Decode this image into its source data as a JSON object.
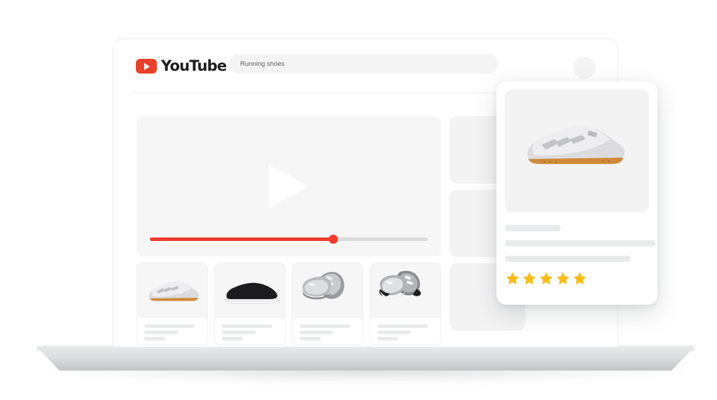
{
  "device": {
    "kind": "laptop-mockup"
  },
  "browser": {
    "brand": {
      "name": "YouTube",
      "logo_icon": "youtube-play-badge-icon",
      "badge_color": "#E8402A"
    },
    "search": {
      "value": "Running shoes",
      "placeholder": "Search"
    },
    "account_avatar_icon": "avatar-circle-icon"
  },
  "video": {
    "play_icon": "play-triangle-icon",
    "progress_percent": 66,
    "progress_color": "#F03C2E",
    "track_color": "#D9DADB"
  },
  "product_thumbnails": [
    {
      "image_icon": "white-gum-sole-sneaker-icon",
      "line_widths": [
        72,
        48,
        30
      ]
    },
    {
      "image_icon": "black-slipon-sneaker-icon",
      "line_widths": [
        72,
        48,
        30
      ]
    },
    {
      "image_icon": "grey-running-shoe-pair-icon",
      "line_widths": [
        72,
        48,
        30
      ]
    },
    {
      "image_icon": "grey-trainer-pair-icon",
      "line_widths": [
        72,
        48,
        30
      ]
    }
  ],
  "sidebar_placeholders": [
    {
      "label": ""
    },
    {
      "label": ""
    },
    {
      "label": ""
    }
  ],
  "overlay_card": {
    "image_icon": "white-gum-sole-sneaker-icon",
    "line_widths": [
      80,
      215,
      180
    ],
    "rating": {
      "value": 5,
      "max": 5,
      "star_icon": "star-filled-icon",
      "star_color": "#F9BC15"
    }
  },
  "palette": {
    "page_background": "#FFFFFF",
    "placeholder_grey": "#F3F3F4",
    "line_grey": "#E9EAEB",
    "divider": "#EDEDEE",
    "brand_red": "#E8402A",
    "star_amber": "#F9BC15"
  }
}
